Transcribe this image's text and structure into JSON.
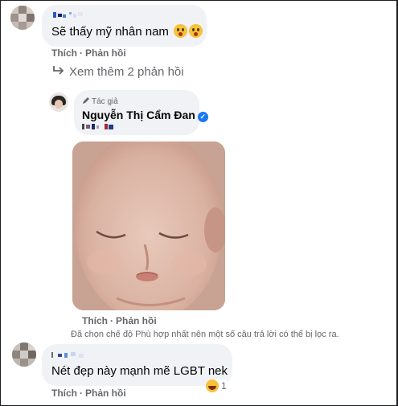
{
  "comments": [
    {
      "text": "Sẽ thấy mỹ nhân nam",
      "like_label": "Thích",
      "reply_label": "Phản hồi",
      "emoji": [
        "astonished-face",
        "astonished-face"
      ]
    }
  ],
  "view_more_label": "Xem thêm 2 phản hồi",
  "author_reply": {
    "badge_label": "Tác giả",
    "name": "Nguyễn Thị Cẩm Đan",
    "like_label": "Thích",
    "reply_label": "Phản hồi",
    "photo_subject": "baby-face-photo"
  },
  "filter_note": "Đã chọn chế độ Phù hợp nhất nên một số câu trả lời có thể bị lọc ra.",
  "second_comment": {
    "text": "Nét đẹp này mạnh mẽ LGBT nek",
    "like_label": "Thích",
    "reply_label": "Phản hồi",
    "reaction_count": "1",
    "reaction_icon": "laughing-face"
  },
  "colors": {
    "bubble": "#f0f2f5",
    "secondary_text": "#65676b",
    "verified": "#1877f2"
  }
}
